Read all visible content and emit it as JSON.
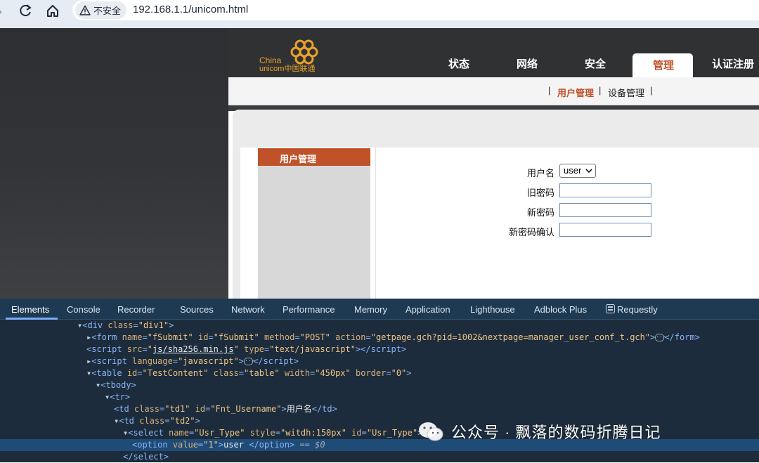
{
  "browser": {
    "security_label": "不安全",
    "url": "192.168.1.1/unicom.html"
  },
  "router": {
    "logo": {
      "line1": "China",
      "line2": "unicom中国联通"
    },
    "nav_tabs": [
      "状态",
      "网络",
      "安全",
      "管理",
      "认证注册"
    ],
    "active_tab": "管理",
    "sub_tabs": [
      "用户管理",
      "设备管理"
    ],
    "active_sub_tab": "用户管理",
    "sidebar_title": "用户管理",
    "form": {
      "username_label": "用户名",
      "username_value": "user",
      "old_password_label": "旧密码",
      "new_password_label": "新密码",
      "confirm_password_label": "新密码确认"
    },
    "brand_color": "#c0522a"
  },
  "devtools": {
    "tabs": [
      "Elements",
      "Console",
      "Recorder",
      "Sources",
      "Network",
      "Performance",
      "Memory",
      "Application",
      "Lighthouse",
      "Adblock Plus",
      "Requestly"
    ],
    "active_tab": "Elements",
    "lines": [
      {
        "indent": 110,
        "tri": "▼",
        "html": "&lt;div <a>class</a>=<v>\"div1\"</v>&gt;"
      },
      {
        "indent": 123,
        "tri": "▶",
        "html": "&lt;form <a>name</a>=<v>\"fSubmit\"</v> <a>id</a>=<v>\"fSubmit\"</v> <a>method</a>=<v>\"POST\"</v> <a>action</a>=<v>\"getpage.gch?pid=1002&amp;nextpage=manager_user_conf_t.gch\"</v>&gt;<e></e>&lt;/form&gt;"
      },
      {
        "indent": 123,
        "tri": "",
        "html": "&lt;script <a>src</a>=<v>\"<l>js/sha256.min.js</l>\"</v> <a>type</a>=<v>\"text/javascript\"</v>&gt;&lt;/script&gt;"
      },
      {
        "indent": 123,
        "tri": "▶",
        "html": "&lt;script <a>language</a>=<v>\"javascript\"</v>&gt;<e></e>&lt;/script&gt;"
      },
      {
        "indent": 123,
        "tri": "▼",
        "html": "&lt;table <a>id</a>=<v>\"TestContent\"</v> <a>class</a>=<v>\"table\"</v> <a>width</a>=<v>\"450px\"</v> <a>border</a>=<v>\"0\"</v>&gt;"
      },
      {
        "indent": 136,
        "tri": "▼",
        "html": "&lt;tbody&gt;"
      },
      {
        "indent": 149,
        "tri": "▼",
        "html": "&lt;tr&gt;"
      },
      {
        "indent": 162,
        "tri": "",
        "html": "&lt;td <a>class</a>=<v>\"td1\"</v> <a>id</a>=<v>\"Fnt_Username\"</v>&gt;<t>用户名</t>&lt;/td&gt;"
      },
      {
        "indent": 162,
        "tri": "▼",
        "html": "&lt;td <a>class</a>=<v>\"td2\"</v>&gt;"
      },
      {
        "indent": 175,
        "tri": "▼",
        "html": "&lt;select <a>name</a>=<v>\"Usr_Type\"</v> <a>style</a>=<v>\"witdh:150px\"</v> <a>id</a>=<v>\"Usr_Type\"</v>&gt;"
      },
      {
        "indent": 188,
        "tri": "",
        "html": "&lt;option <a>value</a>=<v>\"1\"</v>&gt;<t>user </t>&lt;/option&gt; <q>== </q><d>$0</d>",
        "selected": true
      },
      {
        "indent": 175,
        "tri": "",
        "html": "&lt;/select&gt;"
      }
    ]
  },
  "watermark": "公众号 · 飘落的数码折腾日记"
}
